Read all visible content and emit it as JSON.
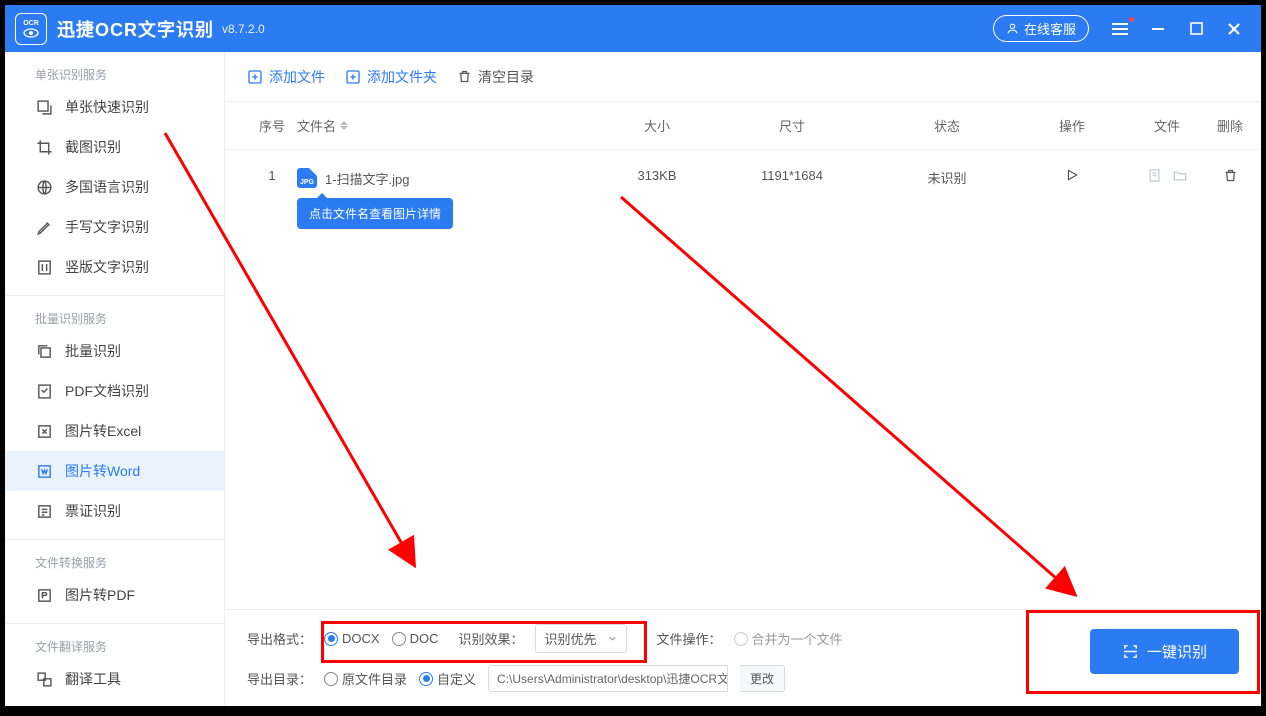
{
  "header": {
    "logo_sub": "OCR",
    "title": "迅捷OCR文字识别",
    "version": "v8.7.2.0",
    "support": "在线客服"
  },
  "sidebar": {
    "groups": [
      {
        "label": "单张识别服务",
        "items": [
          {
            "icon": "single",
            "label": "单张快速识别"
          },
          {
            "icon": "crop",
            "label": "截图识别"
          },
          {
            "icon": "globe",
            "label": "多国语言识别"
          },
          {
            "icon": "pen",
            "label": "手写文字识别"
          },
          {
            "icon": "vertical",
            "label": "竖版文字识别"
          }
        ]
      },
      {
        "label": "批量识别服务",
        "items": [
          {
            "icon": "batch",
            "label": "批量识别"
          },
          {
            "icon": "pdf",
            "label": "PDF文档识别"
          },
          {
            "icon": "xls",
            "label": "图片转Excel"
          },
          {
            "icon": "word",
            "label": "图片转Word",
            "active": true
          },
          {
            "icon": "ticket",
            "label": "票证识别"
          }
        ]
      },
      {
        "label": "文件转换服务",
        "items": [
          {
            "icon": "p",
            "label": "图片转PDF"
          }
        ]
      },
      {
        "label": "文件翻译服务",
        "items": [
          {
            "icon": "translate",
            "label": "翻译工具"
          }
        ]
      }
    ]
  },
  "toolbar": {
    "add_file": "添加文件",
    "add_folder": "添加文件夹",
    "clear": "清空目录"
  },
  "table": {
    "head": {
      "idx": "序号",
      "name": "文件名",
      "size": "大小",
      "dim": "尺寸",
      "status": "状态",
      "op": "操作",
      "file": "文件",
      "del": "删除"
    },
    "rows": [
      {
        "idx": "1",
        "name": "1-扫描文字.jpg",
        "size": "313KB",
        "dim": "1191*1684",
        "status": "未识别"
      }
    ],
    "tooltip": "点击文件名查看图片详情"
  },
  "footer": {
    "format_label": "导出格式：",
    "docx": "DOCX",
    "doc": "DOC",
    "effect_label": "识别效果：",
    "effect_value": "识别优先",
    "fileop_label": "文件操作：",
    "merge": "合并为一个文件",
    "dir_label": "导出目录：",
    "orig_dir": "原文件目录",
    "custom": "自定义",
    "path": "C:\\Users\\Administrator\\desktop\\迅捷OCR文",
    "change": "更改",
    "recognize": "一键识别"
  }
}
